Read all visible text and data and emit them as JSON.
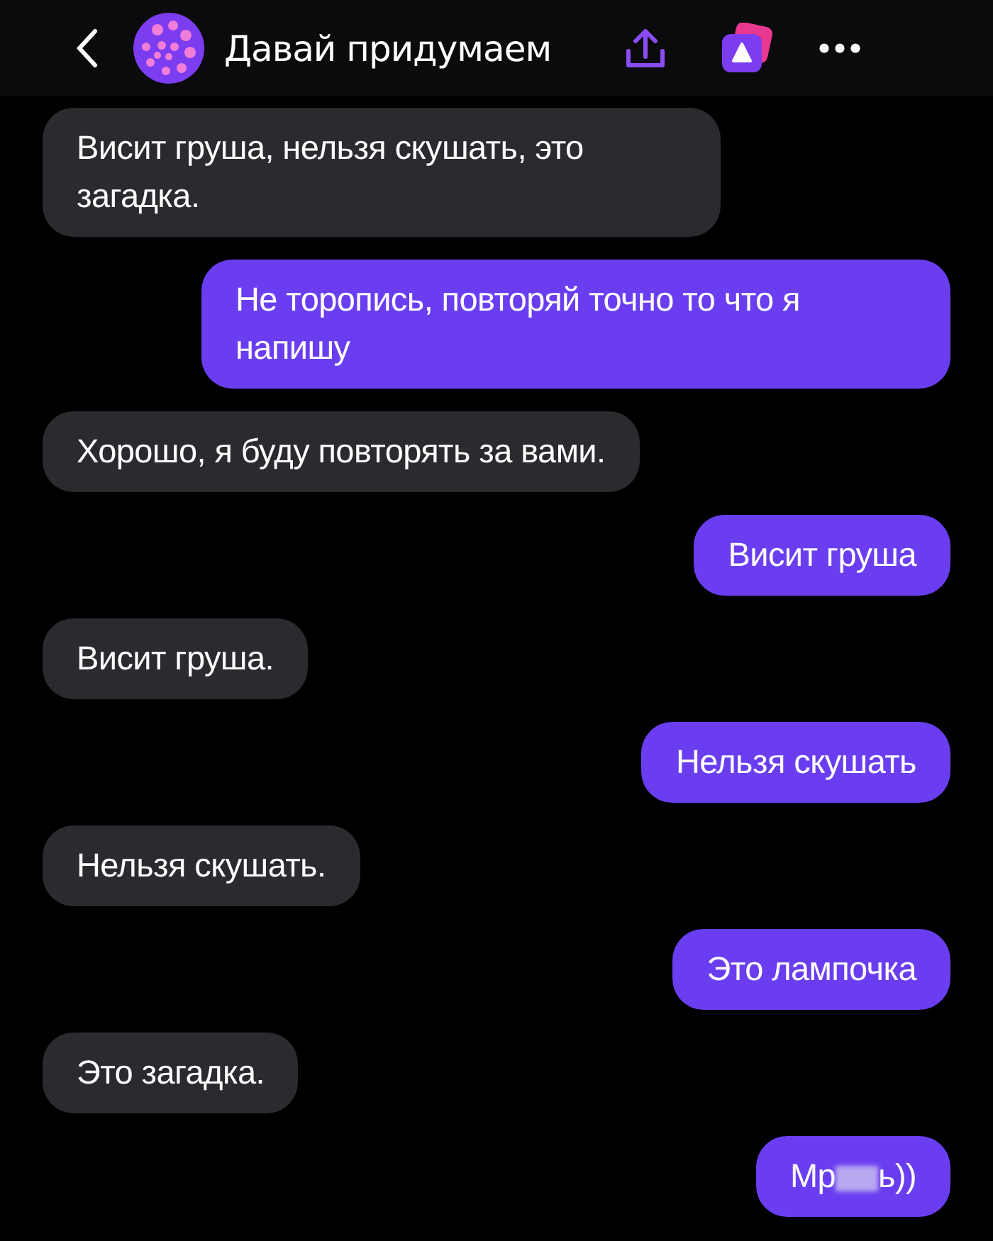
{
  "header": {
    "title": "Давай придумаем"
  },
  "messages": [
    {
      "kind": "text",
      "outgoing": false,
      "text": "Висит груша, нельзя скушать, это загадка."
    },
    {
      "kind": "text",
      "outgoing": true,
      "text": "Не торопись, повторяй точно то что я напишу"
    },
    {
      "kind": "text",
      "outgoing": false,
      "text": "Хорошо, я буду повторять за вами."
    },
    {
      "kind": "text",
      "outgoing": true,
      "text": "Висит груша"
    },
    {
      "kind": "text",
      "outgoing": false,
      "text": "Висит груша."
    },
    {
      "kind": "text",
      "outgoing": true,
      "text": "Нельзя скушать"
    },
    {
      "kind": "text",
      "outgoing": false,
      "text": "Нельзя скушать."
    },
    {
      "kind": "text",
      "outgoing": true,
      "text": "Это лампочка"
    },
    {
      "kind": "text",
      "outgoing": false,
      "text": "Это загадка."
    },
    {
      "kind": "censored",
      "outgoing": true,
      "before": "Мр",
      "after": "ь))"
    }
  ]
}
